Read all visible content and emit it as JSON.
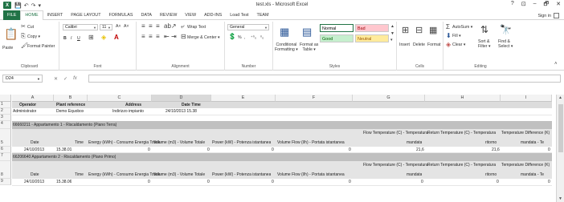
{
  "window": {
    "app_icon": "X",
    "title": "test.xls - Microsoft Excel",
    "controls": [
      "?",
      "⊡",
      "–",
      "🗗",
      "✕"
    ]
  },
  "tabs": {
    "file": "FILE",
    "items": [
      "HOME",
      "INSERT",
      "PAGE LAYOUT",
      "FORMULAS",
      "DATA",
      "REVIEW",
      "VIEW",
      "ADD-INS",
      "Load Test",
      "TEAM"
    ],
    "signin": "Sign in"
  },
  "ribbon": {
    "clipboard": {
      "paste": "Paste",
      "cut": "Cut",
      "copy": "Copy ▾",
      "format_painter": "Format Painter",
      "label": "Clipboard"
    },
    "font": {
      "name": "Calibri",
      "size": "11",
      "label": "Font",
      "bold": "B",
      "italic": "I",
      "underline": "U"
    },
    "alignment": {
      "wrap": "Wrap Text",
      "merge": "Merge & Center ▾",
      "label": "Alignment"
    },
    "number": {
      "format": "General",
      "label": "Number",
      "percent": "%",
      "comma": ","
    },
    "styles": {
      "conditional": "Conditional\nFormatting ▾",
      "format_table": "Format as\nTable ▾",
      "cells": [
        {
          "name": "Normal",
          "bg": "#ffffff",
          "fg": "#000000"
        },
        {
          "name": "Bad",
          "bg": "#ffc7ce",
          "fg": "#9c0006"
        },
        {
          "name": "Good",
          "bg": "#c6efce",
          "fg": "#006100"
        },
        {
          "name": "Neutral",
          "bg": "#ffeb9c",
          "fg": "#9c5700"
        }
      ],
      "label": "Styles"
    },
    "cells": {
      "insert": "Insert",
      "delete": "Delete",
      "format": "Format",
      "label": "Cells"
    },
    "editing": {
      "autosum": "AutoSum ▾",
      "fill": "Fill ▾",
      "clear": "Clear ▾",
      "sort": "Sort &\nFilter ▾",
      "find": "Find &\nSelect ▾",
      "label": "Editing"
    }
  },
  "formula_bar": {
    "name_box": "D24",
    "cancel": "✕",
    "enter": "✓",
    "fx": "fx",
    "value": ""
  },
  "grid": {
    "columns": [
      "A",
      "B",
      "C",
      "D",
      "E",
      "F",
      "G",
      "H",
      "I"
    ],
    "selected_column": "D",
    "row_numbers": [
      "1",
      "2",
      "3",
      "4",
      "5",
      "6",
      "7",
      "8",
      "9"
    ],
    "rows": {
      "r1": [
        "Operator",
        "Plant reference",
        "Address",
        "Date Time"
      ],
      "r2": [
        "Administrator",
        "Demo Equobox",
        "Indirizzo impianto",
        "24/10/2013 15.38"
      ],
      "r4": "66660211 - Appartamento 1 - Riscaldamento (Piano Terra)",
      "r5_top": [
        "Flow Temperature (C) - Temperatura",
        "Return Temperature (C) - Temperatura",
        "Temperature Difference (K)"
      ],
      "r5": [
        "Date",
        "Time",
        "Energy (kWh) - Consumo Energia Totale",
        "Volume (m3) - Volume Totale",
        "Power (kW) - Potenza istantanea",
        "Volume Flow (l/h) - Portata istantanea",
        "mandata",
        "ritorno",
        "mandata - Te"
      ],
      "r6": [
        "24/10/2013",
        "15.38.01",
        "0",
        "0",
        "0",
        "0",
        "21,6",
        "21,6",
        "0"
      ],
      "r7": "66206640 Appartamento 2 - Riscaldamento (Piano Primo)",
      "r8_top": [
        "Flow Temperature (C) - Temperatura",
        "Return Temperature (C) - Temperatura",
        "Temperature Difference (K)"
      ],
      "r8": [
        "Date",
        "Time",
        "Energy (kWh) - Consumo Energia Totale",
        "Volume (m3) - Volume Totale",
        "Power (kW) - Potenza istantanea",
        "Volume Flow (l/h) - Portata istantanea",
        "mandata",
        "ritorno",
        "mandata - Te"
      ],
      "r9": [
        "24/10/2013",
        "15.38.06",
        "0",
        "0",
        "0",
        "0",
        "0",
        "0",
        "0"
      ]
    }
  }
}
